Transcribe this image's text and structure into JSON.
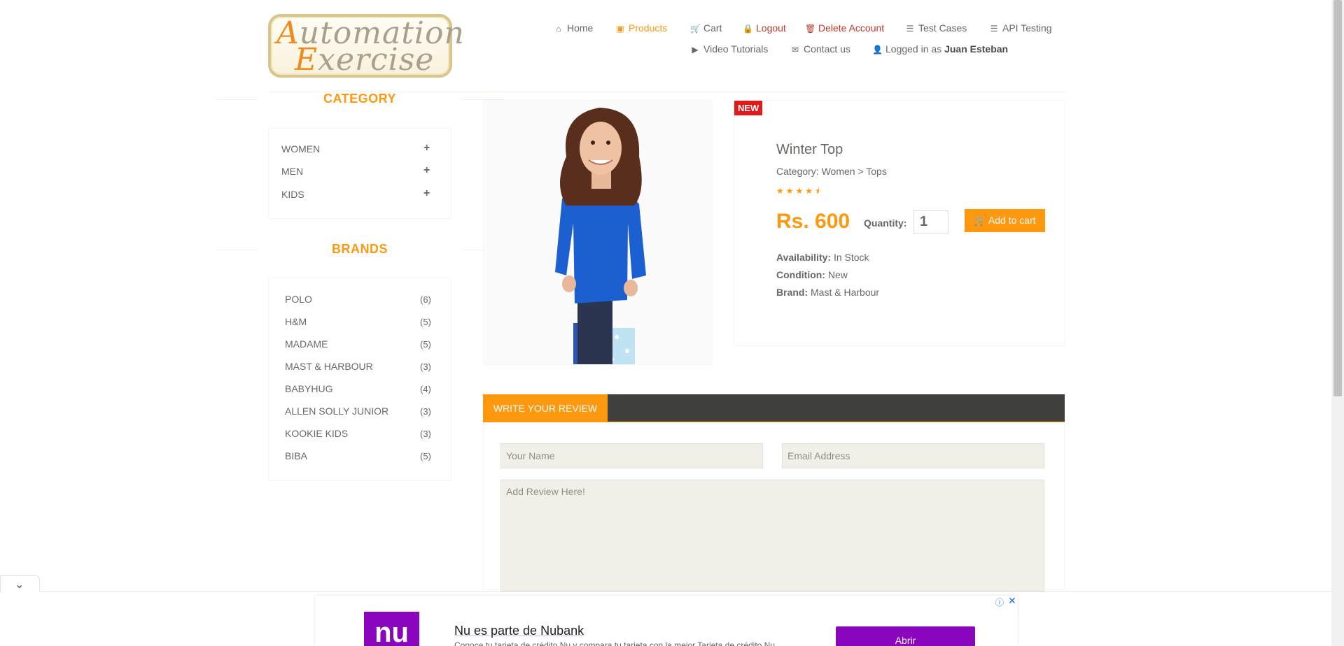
{
  "logo": {
    "line1_cap": "A",
    "line1_rest": "utomation",
    "line2_cap": "E",
    "line2_rest": "xercise"
  },
  "nav": {
    "home": "Home",
    "products": "Products",
    "cart": "Cart",
    "logout": "Logout",
    "delete_account": "Delete Account",
    "test_cases": "Test Cases",
    "api_testing": "API Testing",
    "video_tutorials": "Video Tutorials",
    "contact_us": "Contact us",
    "logged_in_prefix": "Logged in as",
    "logged_in_user": "Juan Esteban"
  },
  "sidebar": {
    "category_title": "CATEGORY",
    "categories": [
      {
        "label": "WOMEN",
        "toggle": "+"
      },
      {
        "label": "MEN",
        "toggle": "+"
      },
      {
        "label": "KIDS",
        "toggle": "+"
      }
    ],
    "brands_title": "BRANDS",
    "brands": [
      {
        "label": "POLO",
        "count": "(6)"
      },
      {
        "label": "H&M",
        "count": "(5)"
      },
      {
        "label": "MADAME",
        "count": "(5)"
      },
      {
        "label": "MAST & HARBOUR",
        "count": "(3)"
      },
      {
        "label": "BABYHUG",
        "count": "(4)"
      },
      {
        "label": "ALLEN SOLLY JUNIOR",
        "count": "(3)"
      },
      {
        "label": "KOOKIE KIDS",
        "count": "(3)"
      },
      {
        "label": "BIBA",
        "count": "(5)"
      }
    ]
  },
  "product": {
    "badge": "NEW",
    "name": "Winter Top",
    "category": "Category: Women > Tops",
    "rating": 4.5,
    "price": "Rs. 600",
    "quantity_label": "Quantity:",
    "quantity_value": "1",
    "add_to_cart": "Add to cart",
    "availability_label": "Availability:",
    "availability_value": "In Stock",
    "condition_label": "Condition:",
    "condition_value": "New",
    "brand_label": "Brand:",
    "brand_value": "Mast & Harbour"
  },
  "review": {
    "tab_label": "WRITE YOUR REVIEW",
    "name_placeholder": "Your Name",
    "email_placeholder": "Email Address",
    "review_placeholder": "Add Review Here!"
  },
  "ad": {
    "logo_text": "nu",
    "headline": "Nu es parte de Nubank",
    "subtext": "Conoce tu tarjeta de crédito Nu y compara tu tarjeta con la mejor Tarjeta de crédito Nu",
    "cta": "Abrir",
    "info_icon": "ⓘ",
    "close_icon": "✕"
  },
  "colors": {
    "accent": "#fe980f",
    "danger": "#c0392b",
    "dark_bar": "#40403e",
    "badge": "#e31919",
    "ad_purple": "#8a05be"
  }
}
